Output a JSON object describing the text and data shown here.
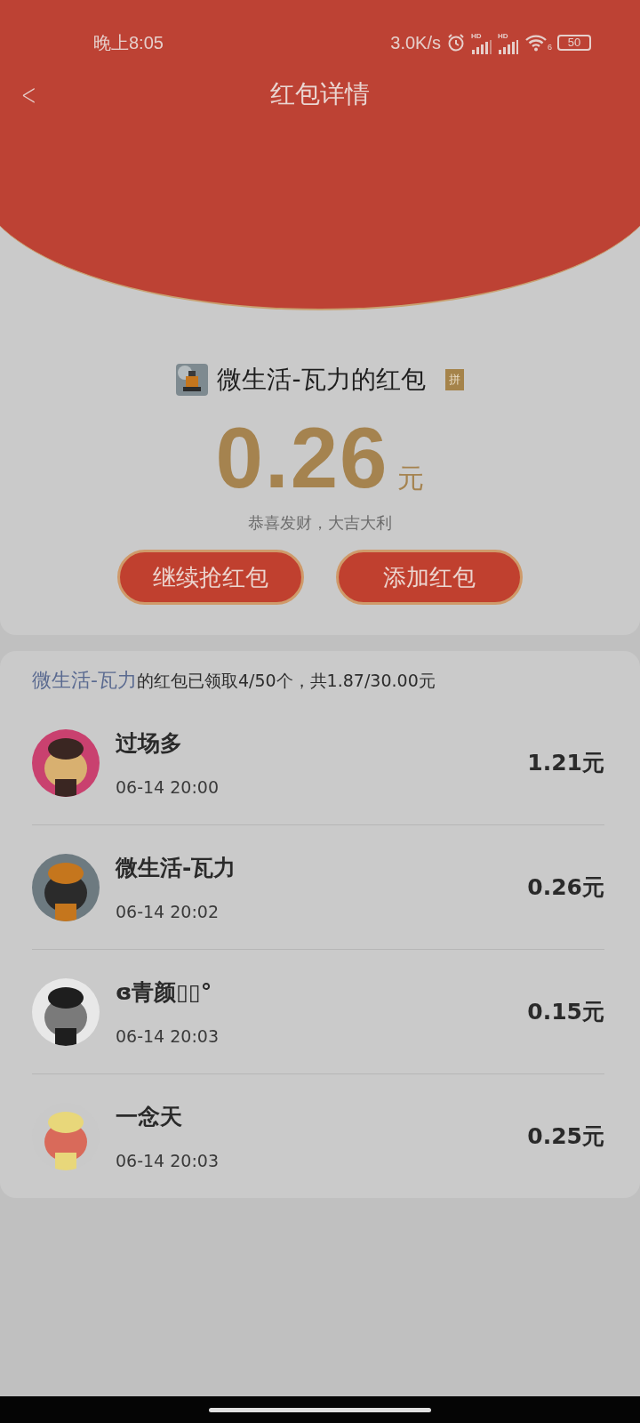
{
  "status_bar": {
    "time": "晚上8:05",
    "speed": "3.0K/s",
    "signal_1_label": "HD",
    "signal_2_label": "HD",
    "wifi_label": "6",
    "battery": "50"
  },
  "header": {
    "back": "<",
    "title": "红包详情"
  },
  "packet": {
    "sender": "微生活-瓦力的红包",
    "badge": "拼",
    "amount": "0.26",
    "unit": "元",
    "greeting": "恭喜发财，大吉大利"
  },
  "buttons": [
    {
      "label": "继续抢红包"
    },
    {
      "label": "添加红包"
    }
  ],
  "summary": {
    "sender": "微生活-瓦力",
    "text": "的红包已领取4/50个，共1.87/30.00元"
  },
  "receivers": [
    {
      "name": "过场多",
      "time": "06-14 20:00",
      "amount": "1.21元"
    },
    {
      "name": "微生活-瓦力",
      "time": "06-14 20:02",
      "amount": "0.26元"
    },
    {
      "name": "ɞ青颜▯▯°",
      "time": "06-14 20:03",
      "amount": "0.15元"
    },
    {
      "name": "一念天",
      "time": "06-14 20:03",
      "amount": "0.25元"
    }
  ]
}
